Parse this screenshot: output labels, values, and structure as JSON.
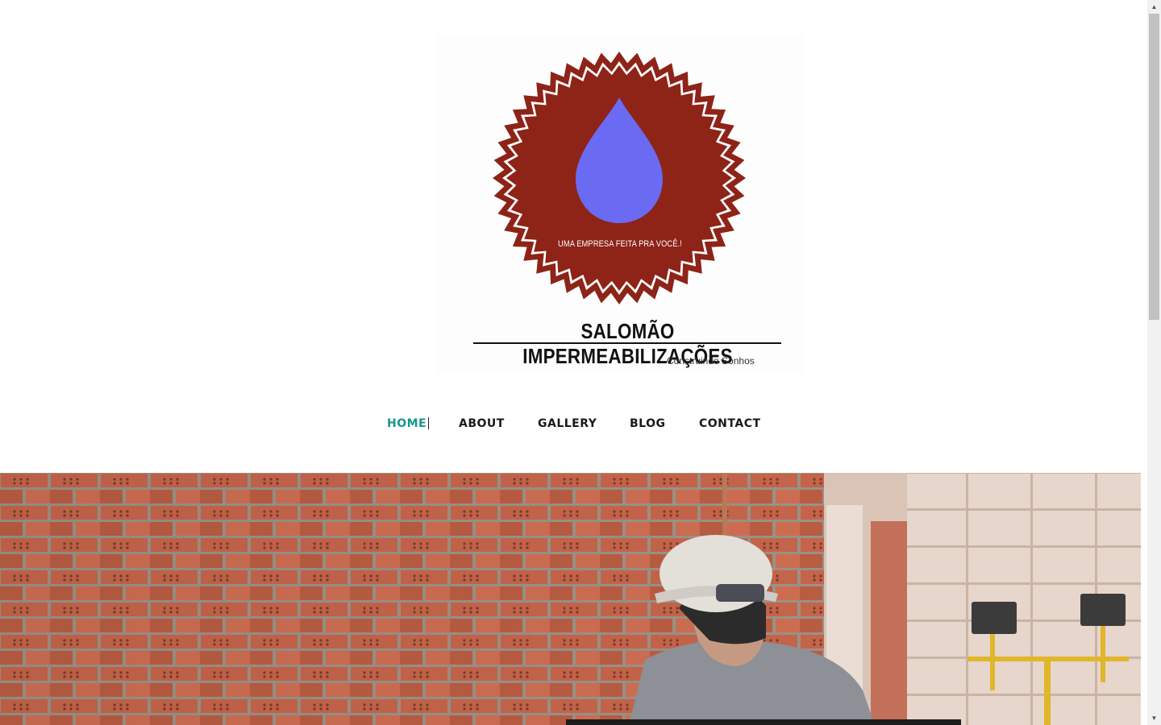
{
  "logo": {
    "tagline": "UMA EMPRESA FEITA PRA  VOCÊ.!",
    "company": "SALOMÃO IMPERMEABILIZAÇÕES",
    "slogan": "Construindo Sonhos",
    "badge_color": "#8e2318",
    "drop_color": "#6a6af2"
  },
  "nav": {
    "items": [
      {
        "label": "HOME",
        "active": true
      },
      {
        "label": "ABOUT",
        "active": false
      },
      {
        "label": "GALLERY",
        "active": false
      },
      {
        "label": "BLOG",
        "active": false
      },
      {
        "label": "CONTACT",
        "active": false
      }
    ],
    "active_color": "#17968e"
  },
  "hero": {
    "image": "construction-worker-brick-wall-photo"
  },
  "scrollbar": {
    "up_icon": "▲",
    "down_icon": "▼"
  }
}
